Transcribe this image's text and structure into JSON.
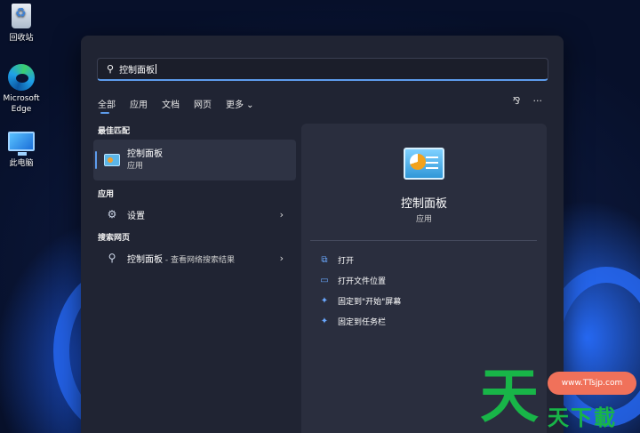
{
  "desktop": {
    "icons": [
      {
        "label": "回收站",
        "icon": "recycle-bin-icon"
      },
      {
        "label": "Microsoft Edge",
        "icon": "edge-icon"
      },
      {
        "label": "此电脑",
        "icon": "this-pc-icon"
      }
    ]
  },
  "search": {
    "value": "控制面板",
    "icon": "search-icon"
  },
  "tabs": [
    {
      "label": "全部",
      "active": true
    },
    {
      "label": "应用"
    },
    {
      "label": "文档"
    },
    {
      "label": "网页"
    },
    {
      "label": "更多 ⌄"
    }
  ],
  "toolbar": {
    "share_icon": "⅋",
    "more_icon": "···"
  },
  "best_match": {
    "heading": "最佳匹配",
    "title": "控制面板",
    "subtitle": "应用"
  },
  "apps": {
    "heading": "应用",
    "items": [
      {
        "label": "设置",
        "icon": "gear-icon"
      }
    ]
  },
  "web": {
    "heading": "搜索网页",
    "items": [
      {
        "label": "控制面板",
        "suffix": " - 查看网络搜索结果",
        "icon": "search-icon"
      }
    ]
  },
  "detail": {
    "title": "控制面板",
    "subtitle": "应用",
    "actions": [
      {
        "label": "打开",
        "icon": "open-icon"
      },
      {
        "label": "打开文件位置",
        "icon": "folder-icon"
      },
      {
        "label": "固定到\"开始\"屏幕",
        "icon": "pin-icon"
      },
      {
        "label": "固定到任务栏",
        "icon": "pin-icon"
      }
    ]
  },
  "watermark": {
    "big": "天",
    "url": "www.TTsjp.com",
    "text": "天下載"
  },
  "colors": {
    "accent": "#5d9cec",
    "panel": "#202433",
    "watermark_green": "#18b548"
  }
}
